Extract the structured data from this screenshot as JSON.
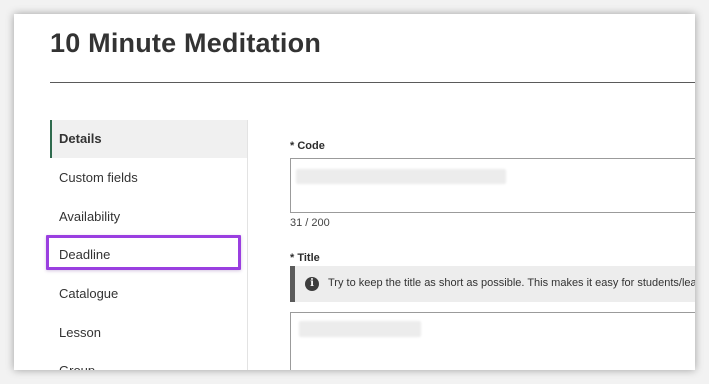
{
  "page": {
    "title": "10 Minute Meditation"
  },
  "sidebar": {
    "items": [
      {
        "label": "Details",
        "active": true
      },
      {
        "label": "Custom fields"
      },
      {
        "label": "Availability"
      },
      {
        "label": "Deadline",
        "highlighted": true
      },
      {
        "label": "Catalogue"
      },
      {
        "label": "Lesson"
      },
      {
        "label": "Group"
      }
    ]
  },
  "form": {
    "code": {
      "label": "* Code",
      "counter": "31 / 200"
    },
    "title": {
      "label": "* Title",
      "hint": "Try to keep the title as short as possible. This makes it easy for students/learners"
    }
  },
  "colors": {
    "highlight": "#9a3fe0",
    "active_border": "#2f6b4e",
    "hint_border": "#5b5b5b"
  },
  "icons": {
    "hint": "info-icon"
  }
}
